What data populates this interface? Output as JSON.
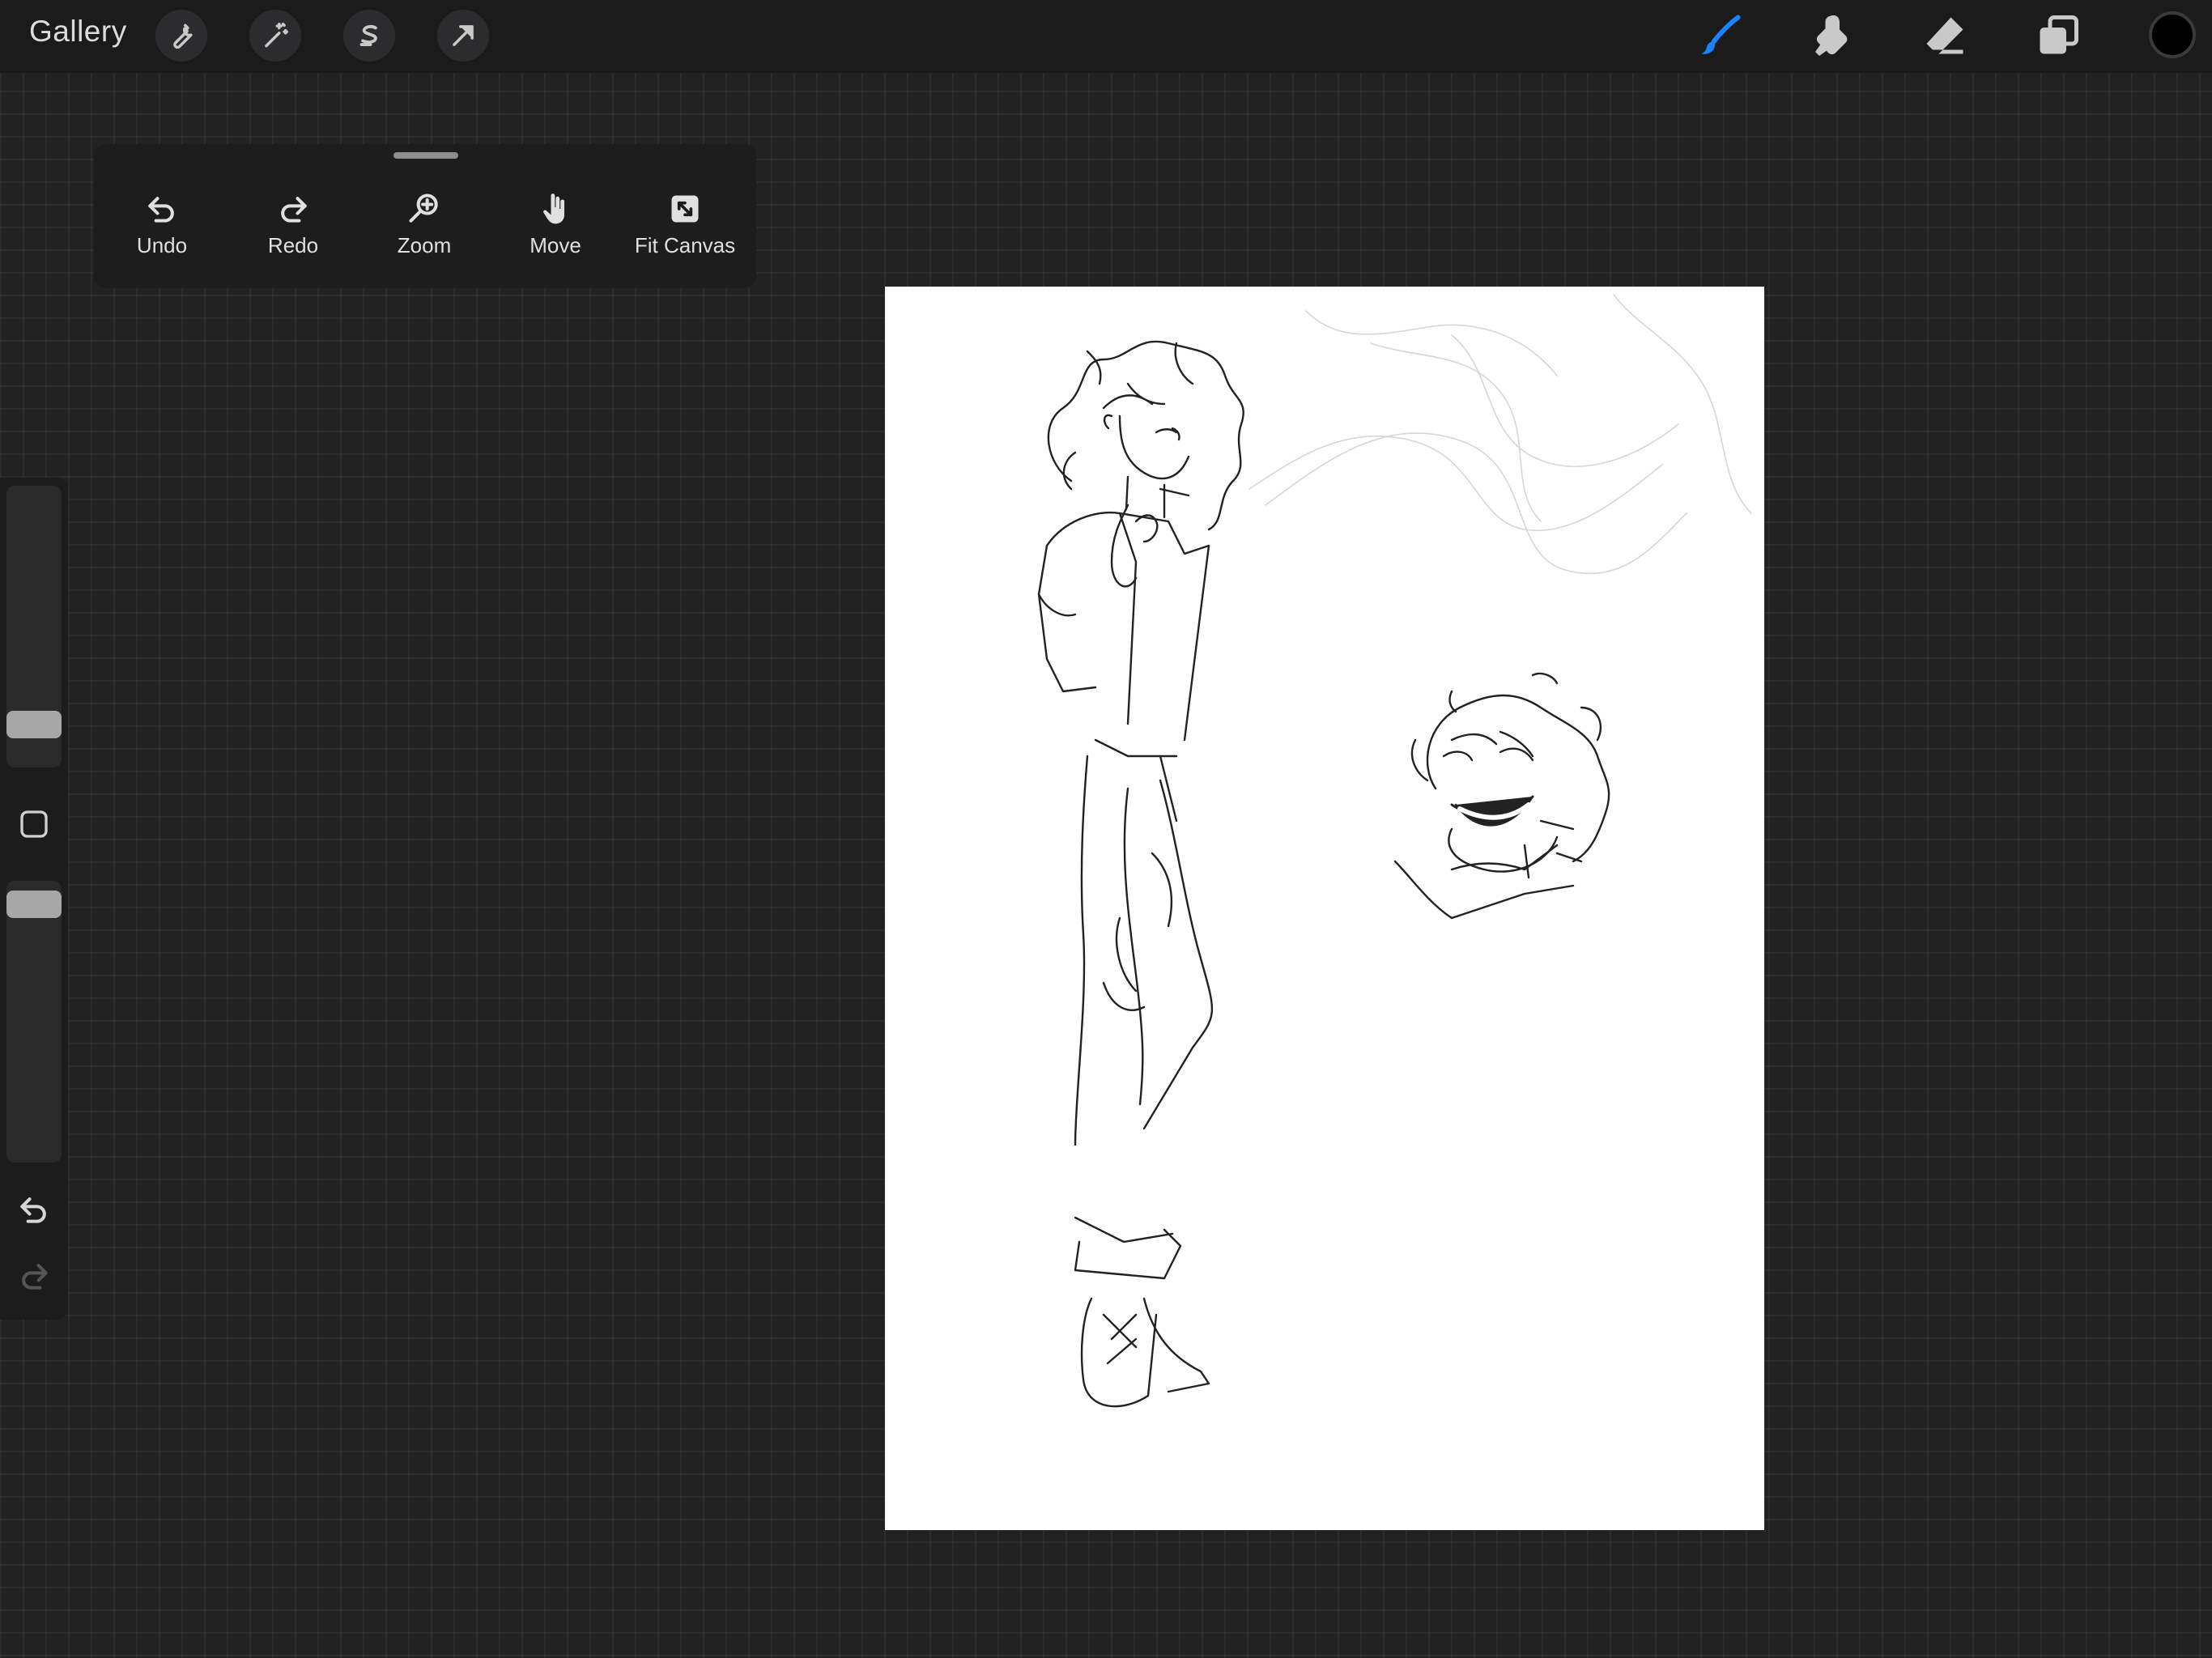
{
  "topbar": {
    "gallery_label": "Gallery",
    "left_tools": [
      {
        "name": "actions",
        "icon": "wrench-icon"
      },
      {
        "name": "adjustments",
        "icon": "magic-wand-icon"
      },
      {
        "name": "selection",
        "icon": "selection-s-icon"
      },
      {
        "name": "transform",
        "icon": "arrow-cursor-icon"
      }
    ],
    "right_tools": [
      {
        "name": "brush",
        "icon": "brush-icon",
        "active": true
      },
      {
        "name": "smudge",
        "icon": "smudge-icon",
        "active": false
      },
      {
        "name": "eraser",
        "icon": "eraser-icon",
        "active": false
      },
      {
        "name": "layers",
        "icon": "layers-icon",
        "active": false
      }
    ],
    "current_color": "#000000",
    "active_tool_color": "#1a82ff"
  },
  "quick_menu": {
    "items": [
      {
        "label": "Undo",
        "icon": "undo-icon"
      },
      {
        "label": "Redo",
        "icon": "redo-icon"
      },
      {
        "label": "Zoom",
        "icon": "zoom-icon"
      },
      {
        "label": "Move",
        "icon": "hand-icon"
      },
      {
        "label": "Fit Canvas",
        "icon": "fit-canvas-icon"
      }
    ]
  },
  "sidebar": {
    "brush_size_level": 0.17,
    "opacity_level": 0.92,
    "modify_button_icon": "square-icon",
    "undo_icon": "undo-icon",
    "redo_icon": "redo-icon"
  },
  "canvas": {
    "background": "#ffffff",
    "content": "sketch-artwork"
  }
}
